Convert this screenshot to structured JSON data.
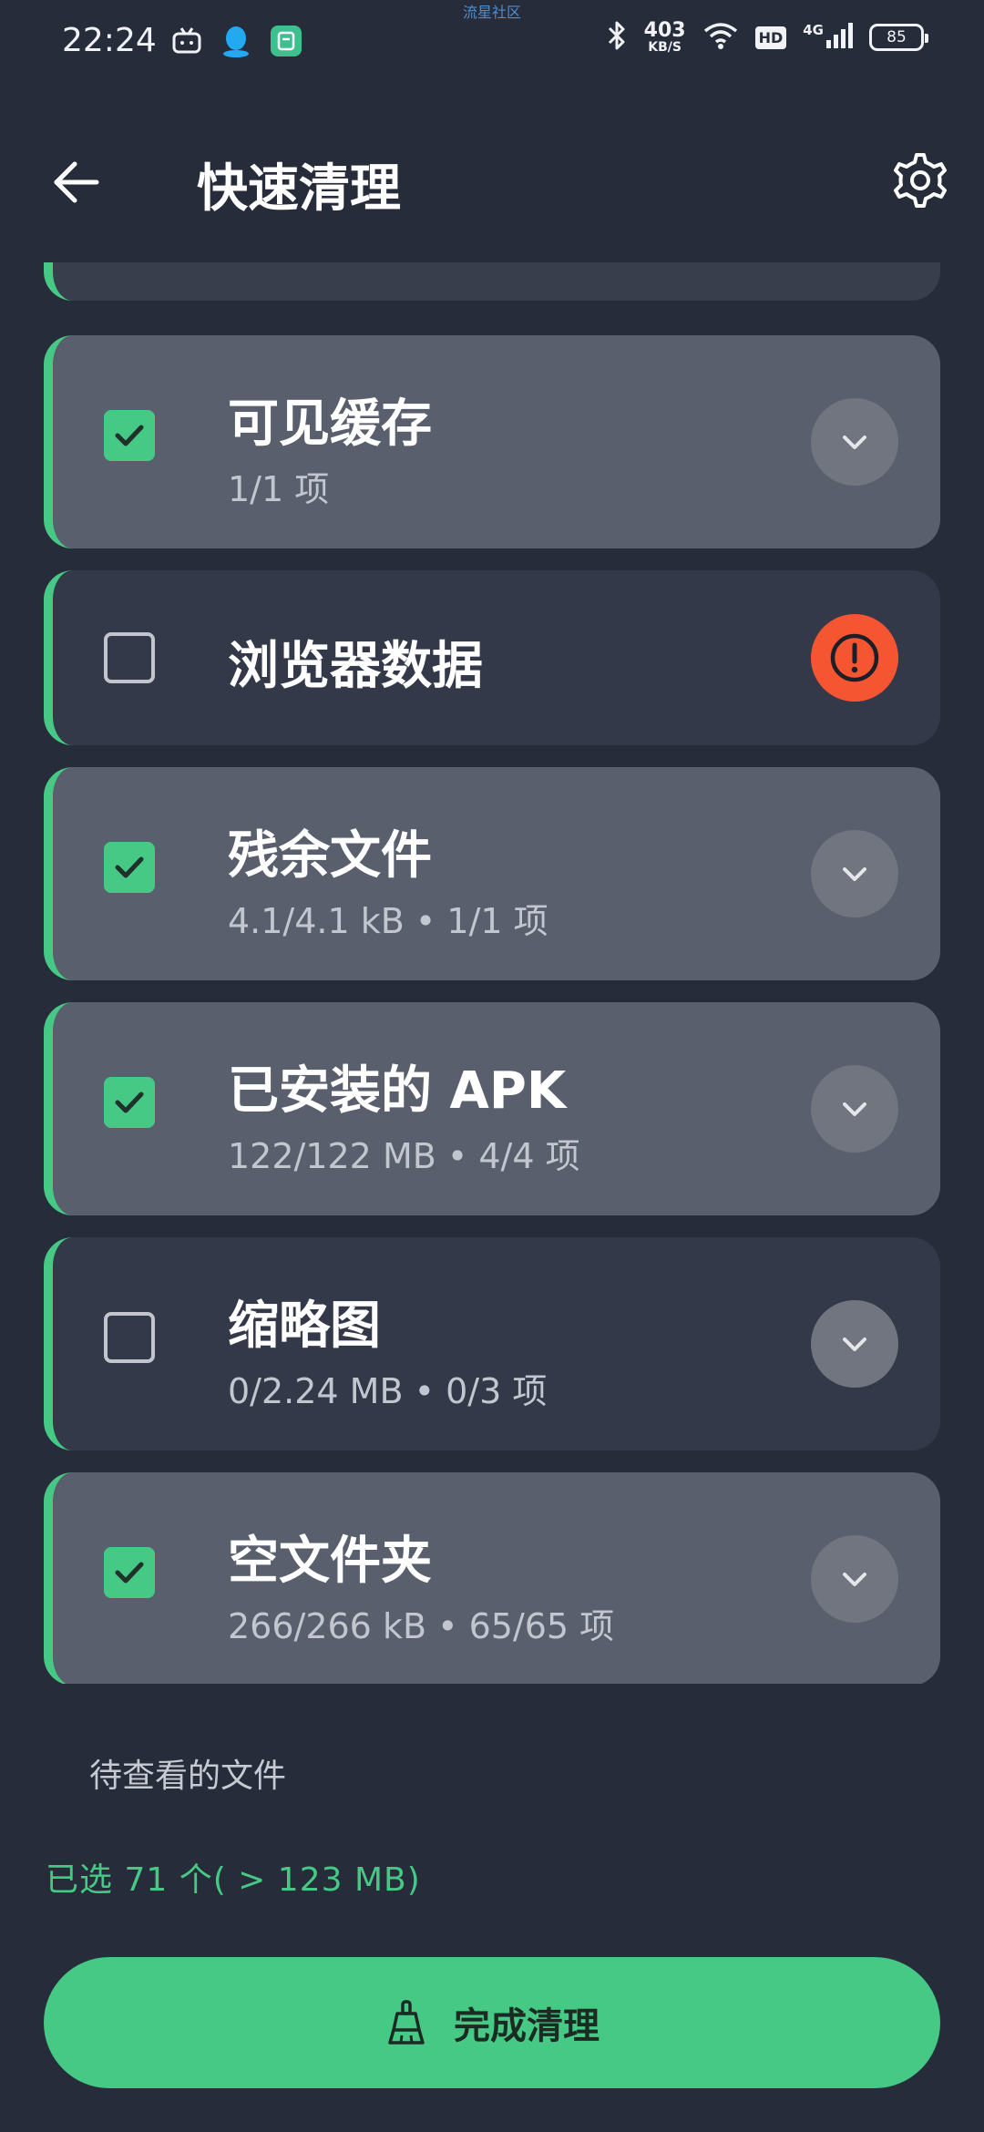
{
  "status_bar": {
    "time": "22:24",
    "watermark": "流星社区",
    "net_speed": "403",
    "net_unit": "KB/S",
    "hd": "HD",
    "network": "4G",
    "battery": "85"
  },
  "header": {
    "title": "快速清理"
  },
  "items": [
    {
      "title": "可见缓存",
      "subtitle": "1/1 项",
      "checked": true
    },
    {
      "title": "浏览器数据",
      "subtitle": "",
      "checked": false
    },
    {
      "title": "残余文件",
      "subtitle": "4.1/4.1 kB • 1/1 项",
      "checked": true
    },
    {
      "title": "已安装的 APK",
      "subtitle": "122/122 MB • 4/4 项",
      "checked": true
    },
    {
      "title": "缩略图",
      "subtitle": "0/2.24 MB • 0/3 项",
      "checked": false
    },
    {
      "title": "空文件夹",
      "subtitle": "266/266 kB • 65/65 项",
      "checked": true
    }
  ],
  "footer": {
    "pending_files": "待查看的文件",
    "selected_summary": "已选 71 个( > 123 MB)",
    "finish_label": "完成清理"
  },
  "colors": {
    "accent": "#45c985",
    "warning": "#f65532",
    "background": "#262c39"
  }
}
